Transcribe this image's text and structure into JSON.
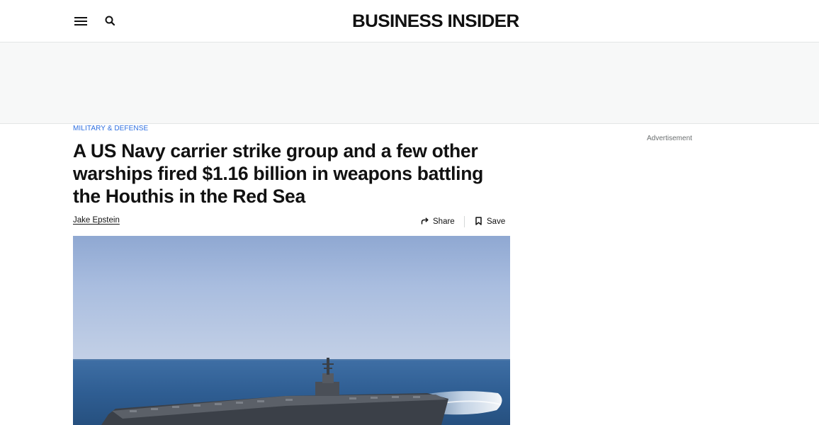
{
  "header": {
    "logo_text": "BUSINESS INSIDER",
    "menu_icon": "hamburger-menu-icon",
    "search_icon": "search-icon"
  },
  "article": {
    "category": "MILITARY & DEFENSE",
    "headline": "A US Navy carrier strike group and a few other warships fired $1.16 billion in weapons battling the Houthis in the Red Sea",
    "author": "Jake Epstein",
    "share_label": "Share",
    "save_label": "Save",
    "share_icon": "share-arrow-icon",
    "save_icon": "bookmark-icon"
  },
  "sidebar": {
    "ad_label": "Advertisement"
  },
  "colors": {
    "accent": "#2f6fe0",
    "text": "#111111",
    "ad_background": "#f7f8f8",
    "sky": "#b7c8e2",
    "sea": "#2e5f93"
  }
}
